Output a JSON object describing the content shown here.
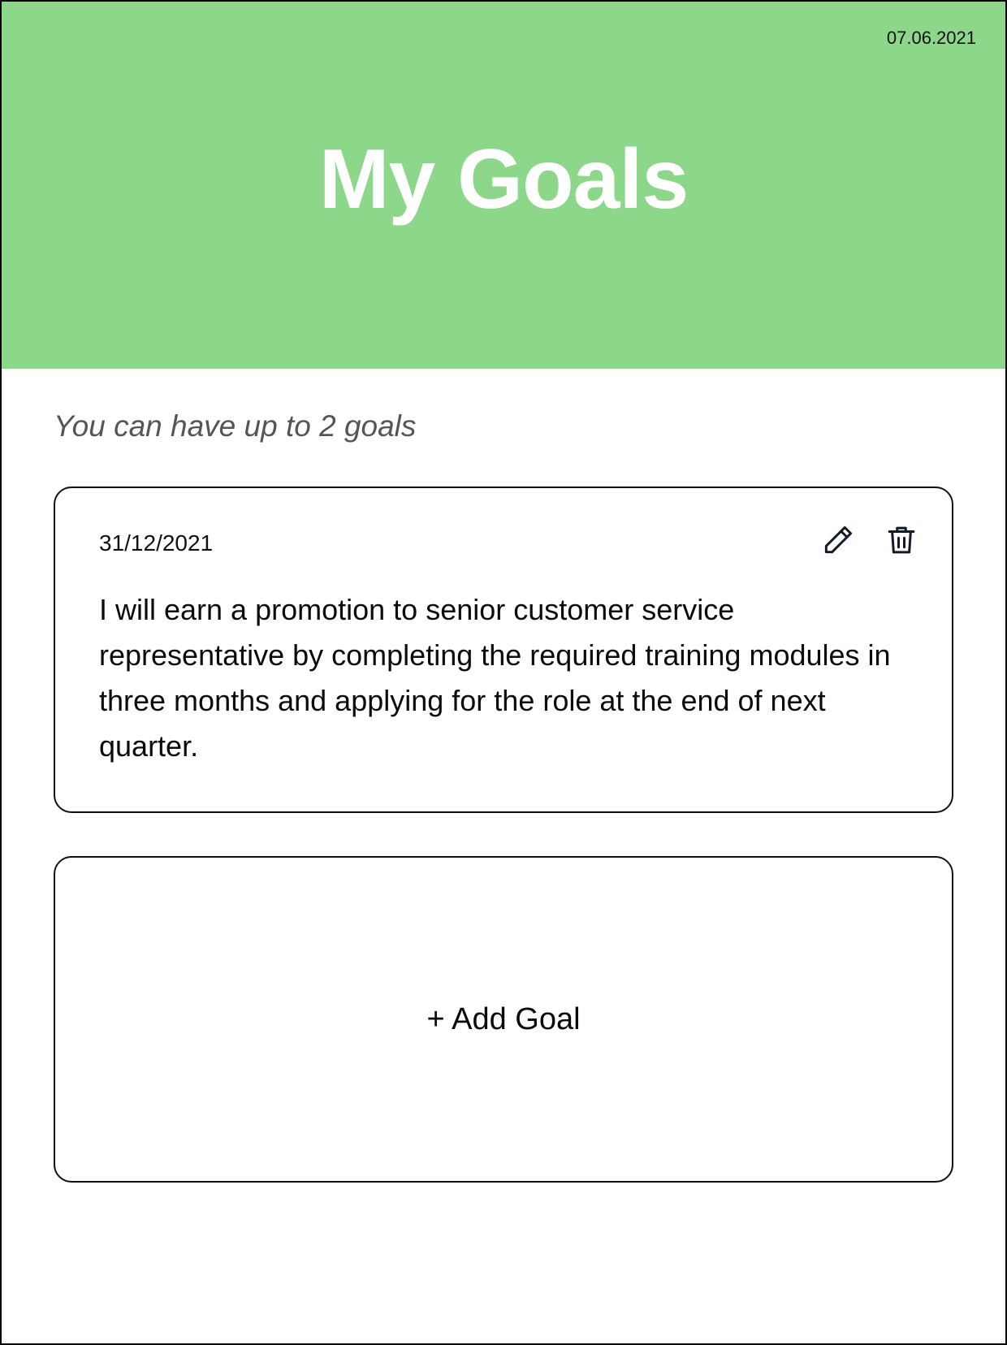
{
  "header": {
    "date": "07.06.2021",
    "title": "My Goals",
    "background_color": "#8dd78a"
  },
  "hint": "You can have up to 2 goals",
  "goals": [
    {
      "date": "31/12/2021",
      "text": "I will earn a promotion to senior customer service representative by completing the required training modules in three months and applying for the role at the end of next quarter.",
      "actions": [
        "pencil-icon",
        "trash-icon"
      ]
    }
  ],
  "add_goal": {
    "label": "+ Add Goal"
  }
}
